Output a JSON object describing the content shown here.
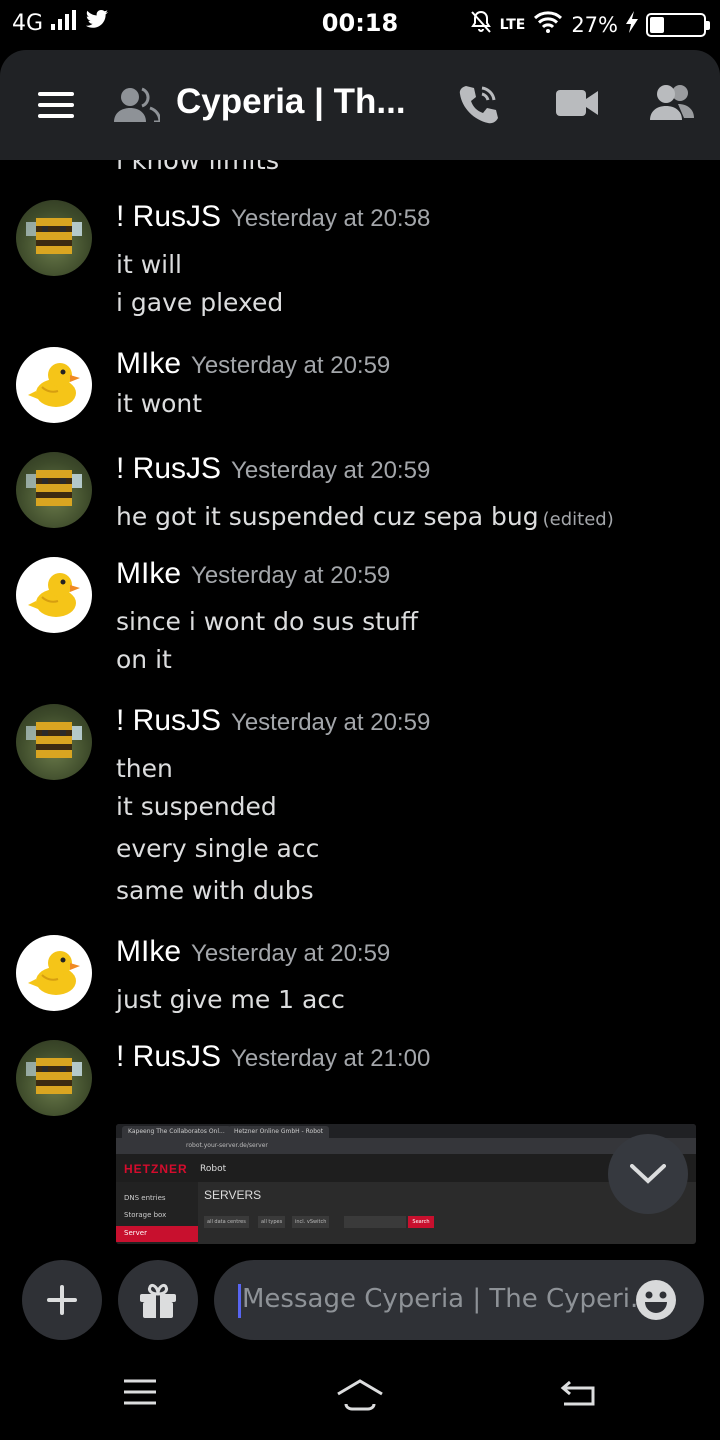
{
  "status_bar": {
    "network": "4G",
    "time": "00:18",
    "lte": "LTE",
    "battery_percent": "27%",
    "battery_level": 0.27
  },
  "header": {
    "title": "Cyperia | Th..."
  },
  "chat": {
    "cut_off_line": "i know limits",
    "messages": [
      {
        "author": "! RusJS",
        "avatar": "bee-avatar",
        "time": "Yesterday at 20:58",
        "lines": [
          "it will",
          "i gave plexed"
        ]
      },
      {
        "author": "MIke",
        "avatar": "duck-avatar",
        "time": "Yesterday at 20:59",
        "lines": [
          "it wont"
        ]
      },
      {
        "author": "! RusJS",
        "avatar": "bee-avatar",
        "time": "Yesterday at 20:59",
        "lines": [
          "he got it suspended cuz sepa bug"
        ],
        "edited": "(edited)"
      },
      {
        "author": "MIke",
        "avatar": "duck-avatar",
        "time": "Yesterday at 20:59",
        "lines": [
          "since i wont do sus stuff",
          "on it"
        ]
      },
      {
        "author": "! RusJS",
        "avatar": "bee-avatar",
        "time": "Yesterday at 20:59",
        "lines": [
          "then",
          "it suspended",
          "every single acc",
          "same with dubs"
        ]
      },
      {
        "author": "MIke",
        "avatar": "duck-avatar",
        "time": "Yesterday at 20:59",
        "lines": [
          "just give me 1 acc"
        ]
      },
      {
        "author": "! RusJS",
        "avatar": "bee-avatar",
        "time": "Yesterday at 21:00",
        "lines": []
      }
    ]
  },
  "attachment": {
    "tab1": "Kapeeng The Collaboratos Onl...",
    "tab2": "Hetzner Online GmbH - Robot",
    "url": "robot.your-server.de/server",
    "logo": "HETZNER",
    "logo_sub": "Robot",
    "side_items": [
      "DNS entries",
      "Storage box",
      "Server"
    ],
    "heading": "SERVERS",
    "filters": [
      "all data centres",
      "all types",
      "incl. vSwitch"
    ],
    "search": "Search"
  },
  "composer": {
    "placeholder": "Message Cyperia | The Cyperi..."
  }
}
